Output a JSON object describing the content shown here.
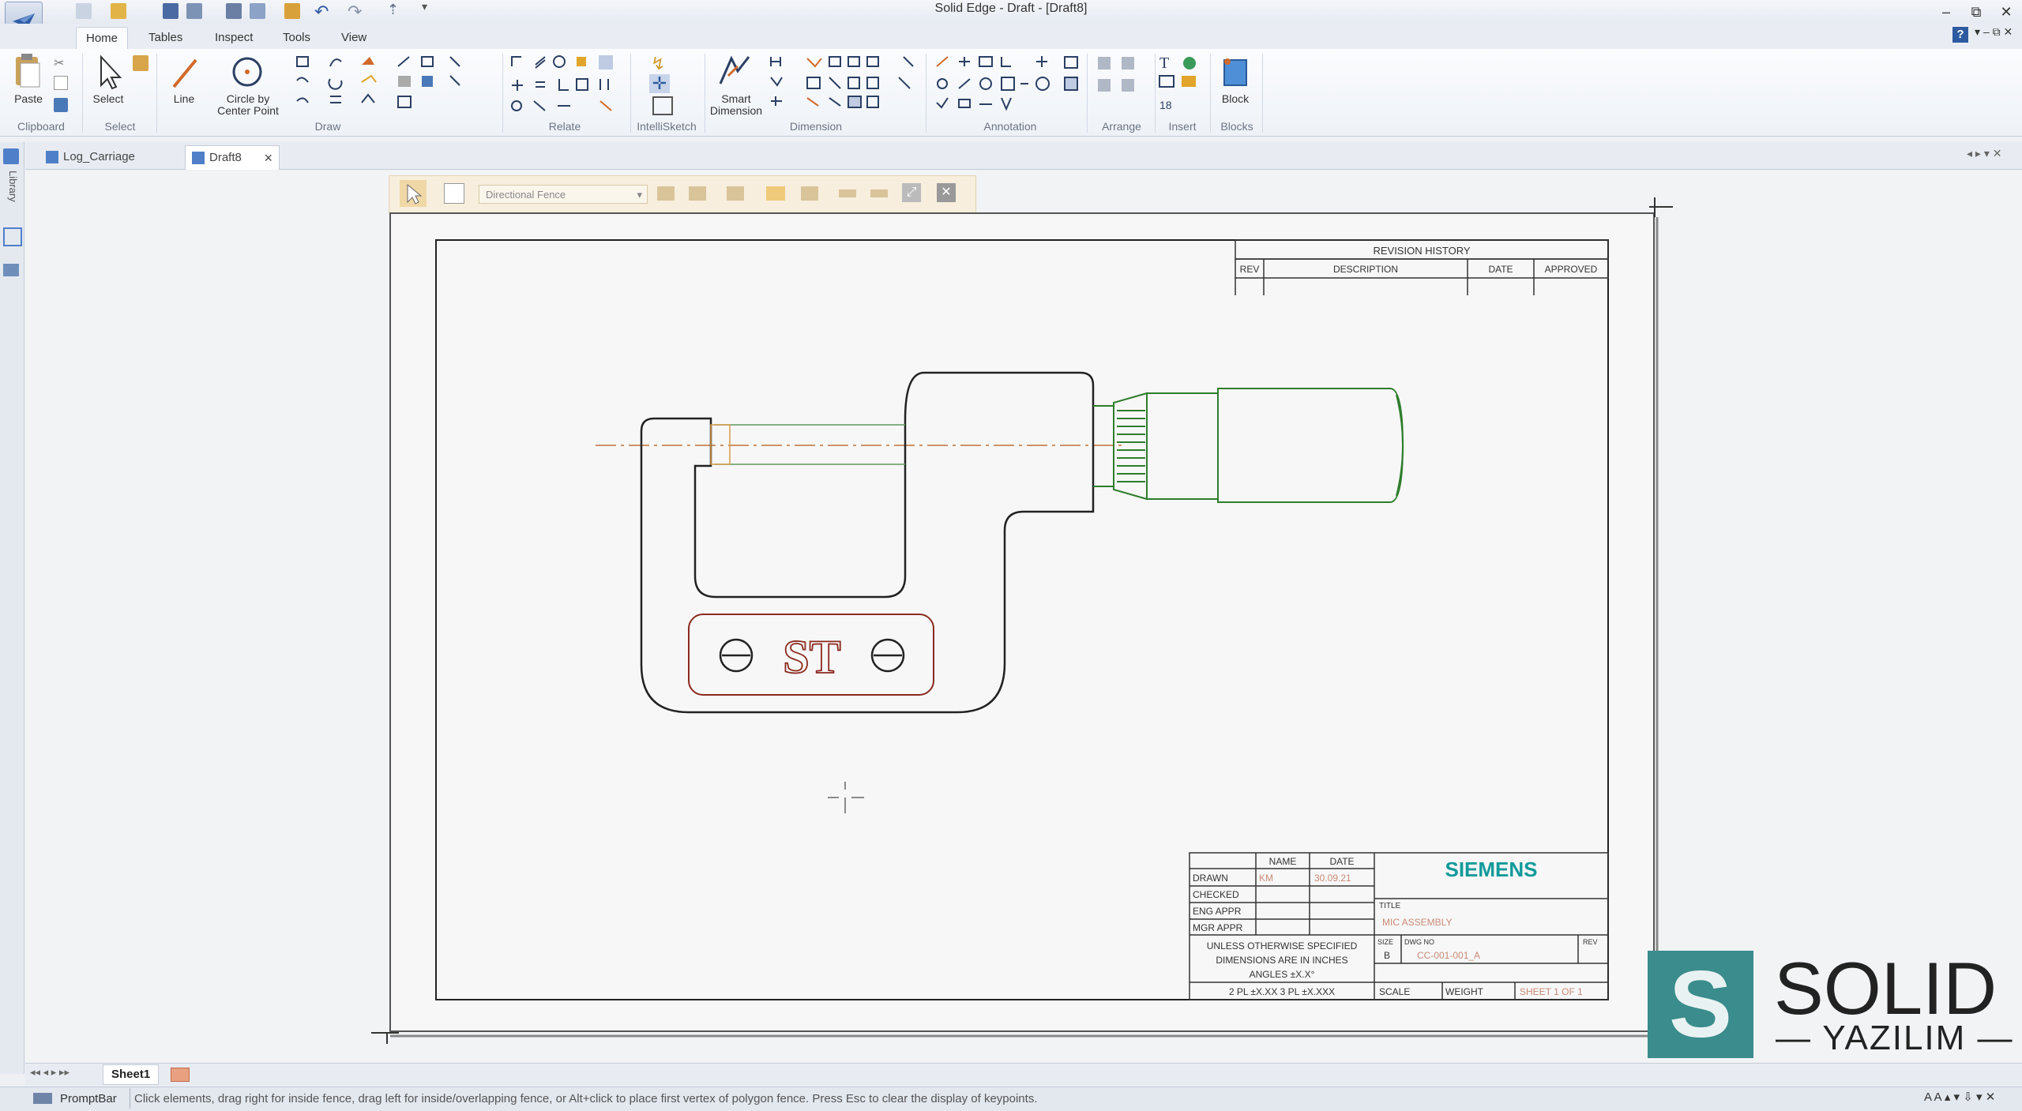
{
  "window": {
    "title": "Solid Edge - Draft - [Draft8]",
    "controls": [
      "–",
      "⧉",
      "✕"
    ]
  },
  "ribbon": {
    "tabs": [
      "Home",
      "Tables",
      "Inspect",
      "Tools",
      "View"
    ],
    "active_tab": "Home",
    "groups": [
      {
        "label": "Clipboard",
        "buttons": [
          "Paste"
        ]
      },
      {
        "label": "Select",
        "buttons": [
          "Select"
        ]
      },
      {
        "label": "Draw",
        "buttons": [
          "Line",
          "Circle by",
          "Center Point"
        ]
      },
      {
        "label": "Relate",
        "buttons": []
      },
      {
        "label": "IntelliSketch",
        "buttons": []
      },
      {
        "label": "Dimension",
        "buttons": [
          "Smart",
          "Dimension"
        ]
      },
      {
        "label": "Annotation",
        "buttons": []
      },
      {
        "label": "Arrange",
        "buttons": []
      },
      {
        "label": "Insert",
        "buttons": []
      },
      {
        "label": "Blocks",
        "buttons": [
          "Block"
        ]
      }
    ]
  },
  "doc_tabs": [
    {
      "label": "Log_Carriage",
      "active": false
    },
    {
      "label": "Draft8",
      "active": true,
      "close": "×"
    }
  ],
  "left_bar": {
    "library_label": "Library"
  },
  "fence_toolbar": {
    "mode": "Directional Fence"
  },
  "drawing": {
    "revision": {
      "title": "REVISION HISTORY",
      "columns": [
        "REV",
        "DESCRIPTION",
        "DATE",
        "APPROVED"
      ]
    },
    "part_logo_text": "ST",
    "title_block": {
      "headers": [
        "NAME",
        "DATE"
      ],
      "rows": [
        {
          "label": "DRAWN",
          "name": "KM",
          "date": "30.09.21"
        },
        {
          "label": "CHECKED",
          "name": "",
          "date": ""
        },
        {
          "label": "ENG APPR",
          "name": "",
          "date": ""
        },
        {
          "label": "MGR APPR",
          "name": "",
          "date": ""
        }
      ],
      "note_lines": [
        "UNLESS OTHERWISE SPECIFIED",
        "DIMENSIONS ARE IN INCHES",
        "ANGLES ±X.X°",
        "2 PL ±X.XX 3 PL ±X.XXX"
      ],
      "company": "SIEMENS",
      "title_label": "TITLE",
      "title_value": "MIC ASSEMBLY",
      "size_label": "SIZE",
      "size_value": "B",
      "dwg_label": "DWG NO",
      "dwg_value": "CC-001-001_A",
      "rev_label": "REV",
      "scale_label": "SCALE",
      "weight_label": "WEIGHT",
      "sheet_label": "SHEET 1 OF 1"
    }
  },
  "watermark": {
    "line1": "SOLID",
    "line2": "— YAZILIM —",
    "letter": "S"
  },
  "sheet_tab": "Sheet1",
  "prompt": {
    "label": "PromptBar",
    "text": "Click elements, drag right for inside fence, drag left for inside/overlapping fence, or Alt+click to place first vertex of polygon fence. Press Esc to clear the display of keypoints."
  },
  "colors": {
    "part_outline": "#222222",
    "spindle_green": "#2e7d2e",
    "logo_red": "#8b2a1f",
    "centerline": "#c0703a",
    "siemens_teal": "#129a9a",
    "watermark_teal": "#3b8c8c"
  }
}
